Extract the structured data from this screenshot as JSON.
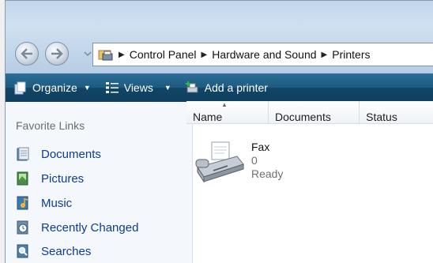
{
  "address": {
    "crumbs": [
      "Control Panel",
      "Hardware and Sound",
      "Printers"
    ]
  },
  "toolbar": {
    "organize": "Organize",
    "views": "Views",
    "add_printer": "Add a printer"
  },
  "sidebar": {
    "heading": "Favorite Links",
    "items": [
      {
        "label": "Documents",
        "icon": "documents-icon"
      },
      {
        "label": "Pictures",
        "icon": "pictures-icon"
      },
      {
        "label": "Music",
        "icon": "music-icon"
      },
      {
        "label": "Recently Changed",
        "icon": "recently-changed-icon"
      },
      {
        "label": "Searches",
        "icon": "searches-icon"
      }
    ]
  },
  "columns": [
    "Name",
    "Documents",
    "Status"
  ],
  "items": [
    {
      "name": "Fax",
      "documents": "0",
      "status": "Ready",
      "icon": "fax-icon"
    }
  ],
  "colors": {
    "toolbar": "#1d5a80",
    "link": "#0b3d91",
    "titlebar": "#c2d6ea"
  }
}
